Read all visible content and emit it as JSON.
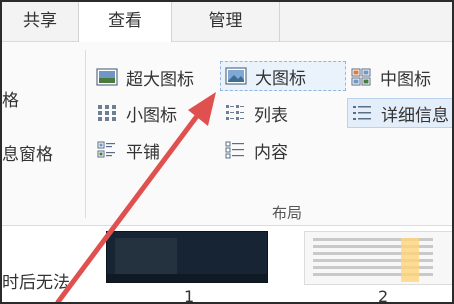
{
  "tabs": [
    {
      "label": "共享"
    },
    {
      "label": "查看"
    },
    {
      "label": "管理"
    }
  ],
  "left_pane": {
    "line1": "格",
    "line2": "息窗格"
  },
  "layout_group": {
    "label": "布局",
    "items": [
      {
        "label": "超大图标",
        "icon": "extra-large-icons-icon"
      },
      {
        "label": "大图标",
        "icon": "large-icons-icon",
        "state": "hovered"
      },
      {
        "label": "中图标",
        "icon": "medium-icons-icon"
      },
      {
        "label": "小图标",
        "icon": "small-icons-icon"
      },
      {
        "label": "列表",
        "icon": "list-view-icon"
      },
      {
        "label": "详细信息",
        "icon": "details-view-icon",
        "state": "selected"
      },
      {
        "label": "平铺",
        "icon": "tiles-view-icon"
      },
      {
        "label": "内容",
        "icon": "content-view-icon"
      }
    ]
  },
  "content_area": {
    "side_text": "时后无法",
    "thumbnails": [
      {
        "label": "1"
      },
      {
        "label": "2"
      }
    ]
  },
  "colors": {
    "arrow": "#e0504f",
    "selected_bg": "#e4eefa",
    "tab_bar_bg": "#f3f3f3"
  }
}
